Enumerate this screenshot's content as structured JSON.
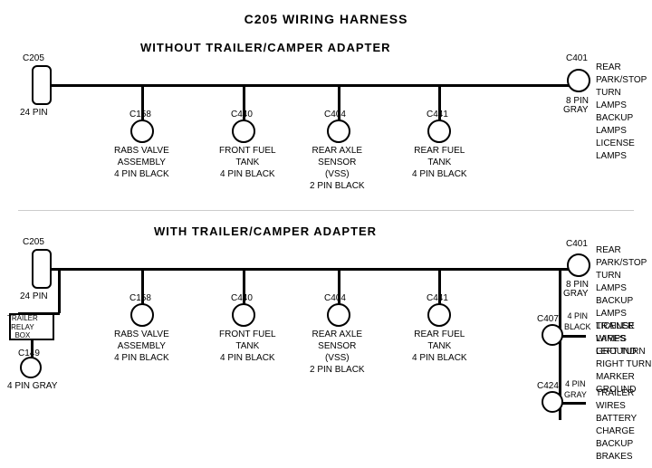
{
  "title": "C205 WIRING HARNESS",
  "section1": {
    "label": "WITHOUT  TRAILER/CAMPER  ADAPTER",
    "left_connector": {
      "id": "C205",
      "pins": "24 PIN"
    },
    "right_connector": {
      "id": "C401",
      "pins": "8 PIN",
      "color": "GRAY",
      "desc": "REAR PARK/STOP\nTURN LAMPS\nBACKUP LAMPS\nLICENSE LAMPS"
    },
    "connectors": [
      {
        "id": "C158",
        "desc": "RABS VALVE\nASSEMBLY\n4 PIN BLACK"
      },
      {
        "id": "C440",
        "desc": "FRONT FUEL\nTANK\n4 PIN BLACK"
      },
      {
        "id": "C404",
        "desc": "REAR AXLE\nSENSOR\n(VSS)\n2 PIN BLACK"
      },
      {
        "id": "C441",
        "desc": "REAR FUEL\nTANK\n4 PIN BLACK"
      }
    ]
  },
  "section2": {
    "label": "WITH  TRAILER/CAMPER  ADAPTER",
    "left_connector": {
      "id": "C205",
      "pins": "24 PIN"
    },
    "right_connector": {
      "id": "C401",
      "pins": "8 PIN",
      "color": "GRAY",
      "desc": "REAR PARK/STOP\nTURN LAMPS\nBACKUP LAMPS\nLICENSE LAMPS\nGROUND"
    },
    "extra_left": {
      "box": "TRAILER\nRELAY\nBOX",
      "id": "C149",
      "pins": "4 PIN GRAY"
    },
    "connectors": [
      {
        "id": "C158",
        "desc": "RABS VALVE\nASSEMBLY\n4 PIN BLACK"
      },
      {
        "id": "C440",
        "desc": "FRONT FUEL\nTANK\n4 PIN BLACK"
      },
      {
        "id": "C404",
        "desc": "REAR AXLE\nSENSOR\n(VSS)\n2 PIN BLACK"
      },
      {
        "id": "C441",
        "desc": "REAR FUEL\nTANK\n4 PIN BLACK"
      }
    ],
    "right_connectors": [
      {
        "id": "C407",
        "pins": "4 PIN\nBLACK",
        "desc": "TRAILER WIRES\nLEFT TURN\nRIGHT TURN\nMARKER\nGROUND"
      },
      {
        "id": "C424",
        "pins": "4 PIN\nGRAY",
        "desc": "TRAILER WIRES\nBATTERY CHARGE\nBACKUP\nBRAKES"
      }
    ]
  }
}
